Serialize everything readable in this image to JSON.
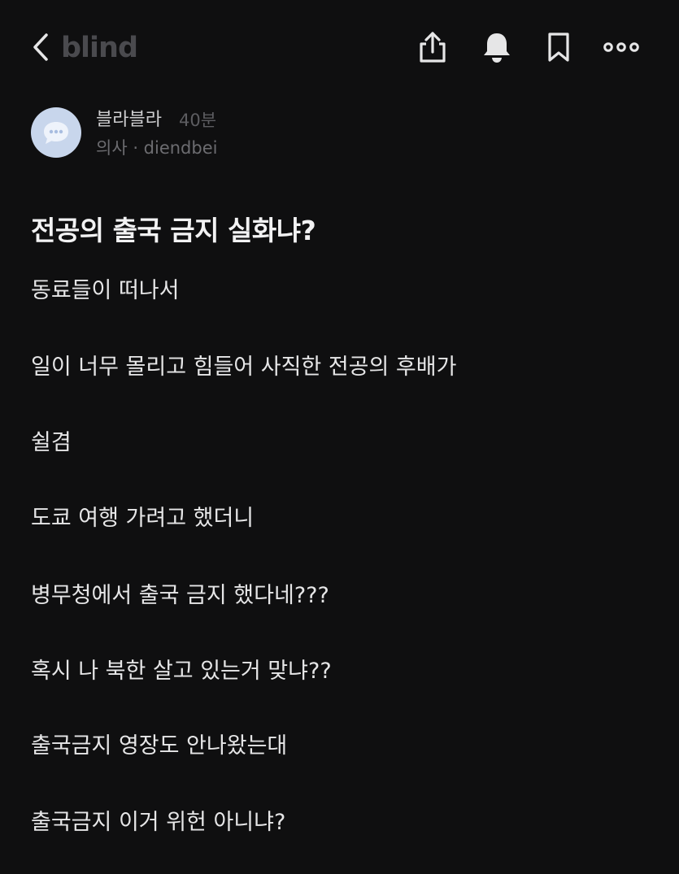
{
  "header": {
    "brand": "blind",
    "icons": {
      "back": "chevron-left-icon",
      "share": "share-icon",
      "notify": "bell-icon",
      "bookmark": "bookmark-icon",
      "more": "more-horizontal-icon"
    }
  },
  "author": {
    "name": "블라블라",
    "time": "40분",
    "meta": "의사 · diendbei",
    "avatar_icon": "chat-bubble-icon",
    "avatar_color": "#c8d6ec"
  },
  "post": {
    "title": "전공의 출국 금지 실화냐?",
    "lines": [
      "동료들이 떠나서",
      "일이 너무 몰리고 힘들어 사직한 전공의 후배가",
      "쉴겸",
      "도쿄 여행 가려고 했더니",
      "병무청에서 출국 금지 했다네???",
      "혹시 나 북한 살고 있는거 맞냐??",
      "출국금지 영장도 안나왔는대",
      "출국금지 이거 위헌 아니냐?"
    ]
  }
}
